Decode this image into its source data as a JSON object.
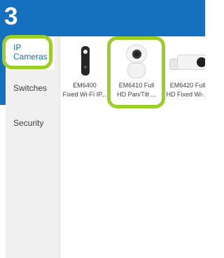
{
  "step": "3",
  "categories": [
    {
      "label": "IP Cameras",
      "active": true
    },
    {
      "label": "Switches",
      "active": false
    },
    {
      "label": "Security",
      "active": false
    }
  ],
  "products": [
    {
      "line1": "EM6400",
      "line2": "Fixed Wi-Fi IP..."
    },
    {
      "line1": "EM6410 Full",
      "line2": "HD Pan/Tilt ..."
    },
    {
      "line1": "EM6420 Full",
      "line2": "HD Fixed Wi-..."
    }
  ],
  "colors": {
    "header_blue": "#1570bf",
    "highlight_green": "#9bcf28",
    "sidebar_gray": "#f0f0f0"
  }
}
